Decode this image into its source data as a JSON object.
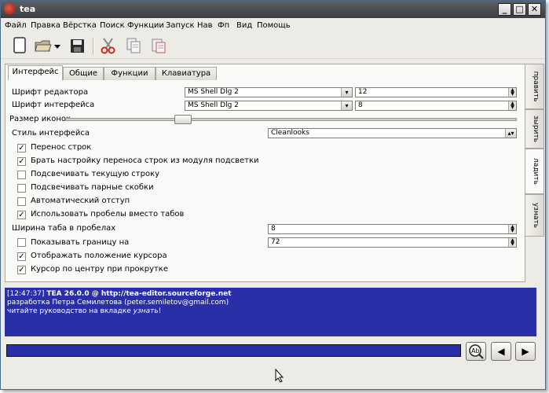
{
  "window": {
    "title": "tea"
  },
  "menu": [
    "Файл",
    "Правка",
    "Вёрстка",
    "Поиск",
    "Функции",
    "Запуск",
    "Нав",
    "Фп",
    "Вид",
    "Помощь"
  ],
  "toolbar": {
    "icons": [
      "new-file-icon",
      "open-file-icon",
      "dropdown-arrow-icon",
      "save-icon",
      "cut-icon",
      "copy-icon",
      "paste-icon"
    ]
  },
  "tabs": [
    "Интерфейс",
    "Общие",
    "Функции",
    "Клавиатура"
  ],
  "side_tabs": [
    "править",
    "зырить",
    "ладить",
    "узнать"
  ],
  "settings": {
    "editor_font_label": "Шрифт редактора",
    "editor_font_value": "MS Shell Dlg 2",
    "editor_font_size": "12",
    "ui_font_label": "Шрифт интерфейса",
    "ui_font_value": "MS Shell Dlg 2",
    "ui_font_size": "8",
    "icon_size_label": "Размер иконок",
    "icon_size_level": 0.26,
    "style_label": "Стиль интерфейса",
    "style_value": "Cleanlooks",
    "checks": [
      {
        "label": "Перенос строк",
        "checked": true
      },
      {
        "label": "Брать настройку переноса строк из модуля подсветки",
        "checked": true
      },
      {
        "label": "Подсвечивать текущую строку",
        "checked": false
      },
      {
        "label": "Подсвечивать парные скобки",
        "checked": false
      },
      {
        "label": "Автоматический отступ",
        "checked": false
      },
      {
        "label": "Использовать пробелы вместо табов",
        "checked": true
      }
    ],
    "tab_width_label": "Ширина таба в пробелах",
    "tab_width_value": "8",
    "margin_label": "Показывать границу на",
    "margin_checked": false,
    "margin_value": "72",
    "checks2": [
      {
        "label": "Отображать положение курсора",
        "checked": true
      },
      {
        "label": "Курсор по центру при прокрутке",
        "checked": true
      }
    ]
  },
  "log": {
    "line1_time": "[12:47:37]",
    "line1_text": "TEA 26.0.0 @ http://tea-editor.sourceforge.net",
    "line2": "разработка Петра Семилетова (peter.semiletov@gmail.com)",
    "line3_pre": "читайте руководство на вкладке",
    "line3_em": "узнать",
    "line3_post": "!"
  },
  "colors": {
    "log_bg": "#2a2fa7",
    "titlebar": "#4a4c50"
  }
}
